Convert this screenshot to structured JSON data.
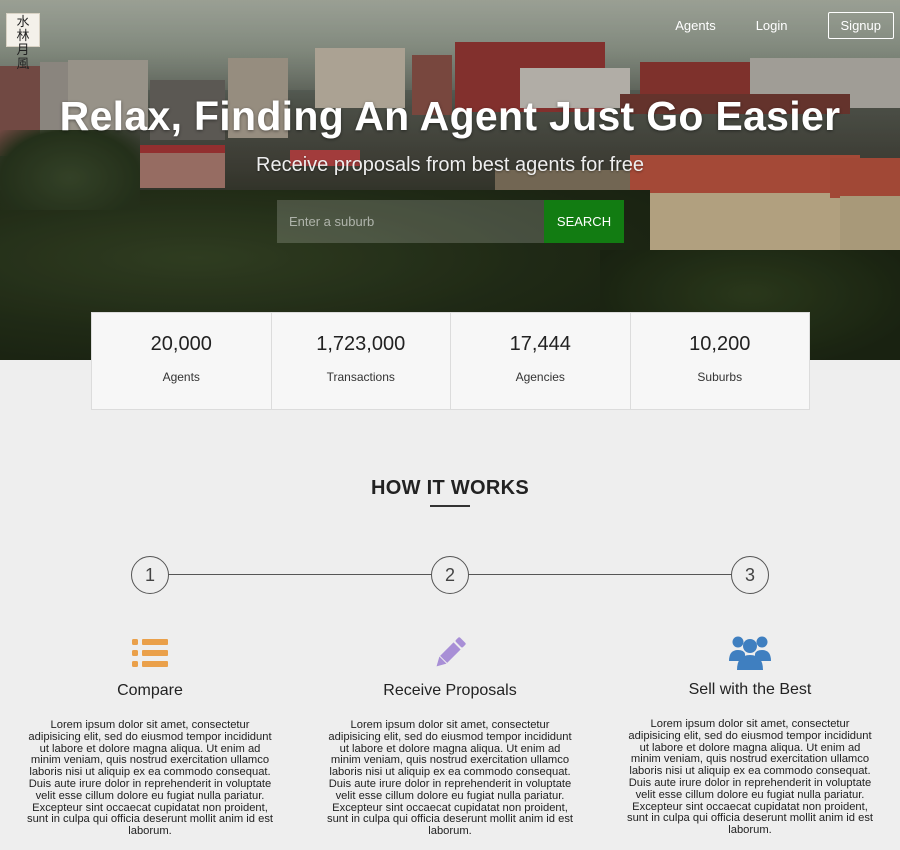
{
  "brand": {
    "logo_glyphs": [
      "水",
      "林",
      "月",
      "風"
    ]
  },
  "nav": {
    "agents_label": "Agents",
    "login_label": "Login",
    "signup_label": "Signup"
  },
  "hero": {
    "title": "Relax, Finding An Agent Just Go Easier",
    "subtitle": "Receive proposals from best agents for free",
    "search_placeholder": "Enter a suburb",
    "search_button": "SEARCH"
  },
  "stats": [
    {
      "value": "20,000",
      "label": "Agents"
    },
    {
      "value": "1,723,000",
      "label": "Transactions"
    },
    {
      "value": "17,444",
      "label": "Agencies"
    },
    {
      "value": "10,200",
      "label": "Suburbs"
    }
  ],
  "how_it_works": {
    "title": "HOW IT WORKS",
    "steps": [
      "1",
      "2",
      "3"
    ],
    "columns": [
      {
        "icon": "list-icon",
        "title": "Compare",
        "text": "Lorem ipsum dolor sit amet, consectetur adipisicing elit, sed do eiusmod tempor incididunt ut labore et dolore magna aliqua. Ut enim ad minim veniam, quis nostrud exercitation ullamco laboris nisi ut aliquip ex ea commodo consequat. Duis aute irure dolor in reprehenderit in voluptate velit esse cillum dolore eu fugiat nulla pariatur. Excepteur sint occaecat cupidatat non proident, sunt in culpa qui officia deserunt mollit anim id est laborum."
      },
      {
        "icon": "pencil-icon",
        "title": "Receive Proposals",
        "text": "Lorem ipsum dolor sit amet, consectetur adipisicing elit, sed do eiusmod tempor incididunt ut labore et dolore magna aliqua. Ut enim ad minim veniam, quis nostrud exercitation ullamco laboris nisi ut aliquip ex ea commodo consequat. Duis aute irure dolor in reprehenderit in voluptate velit esse cillum dolore eu fugiat nulla pariatur. Excepteur sint occaecat cupidatat non proident, sunt in culpa qui officia deserunt mollit anim id est laborum."
      },
      {
        "icon": "users-icon",
        "title": "Sell with the Best",
        "text": "Lorem ipsum dolor sit amet, consectetur adipisicing elit, sed do eiusmod tempor incididunt ut labore et dolore magna aliqua. Ut enim ad minim veniam, quis nostrud exercitation ullamco laboris nisi ut aliquip ex ea commodo consequat. Duis aute irure dolor in reprehenderit in voluptate velit esse cillum dolore eu fugiat nulla pariatur. Excepteur sint occaecat cupidatat non proident, sunt in culpa qui officia deserunt mollit anim id est laborum."
      }
    ]
  },
  "colors": {
    "search_button": "#127c12",
    "icon_compare": "#eaa04a",
    "icon_proposals": "#a88fd6",
    "icon_best": "#3f7fc0"
  }
}
